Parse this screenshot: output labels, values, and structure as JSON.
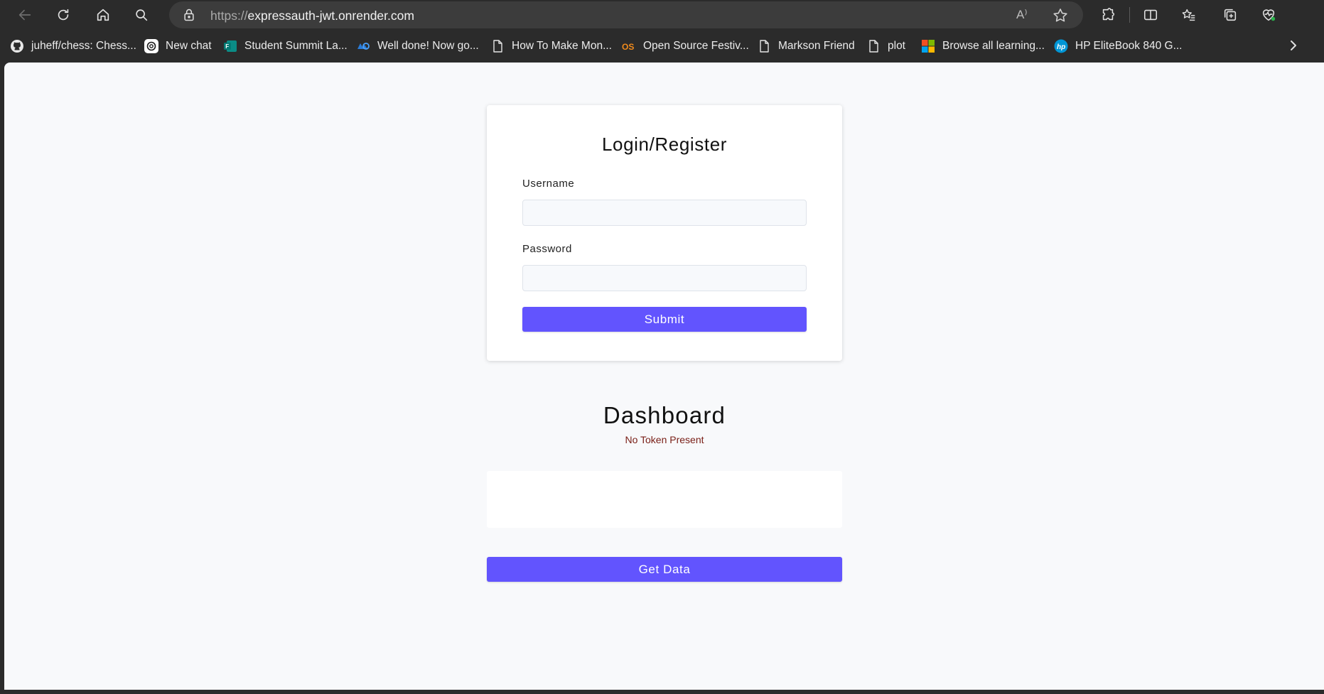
{
  "browser": {
    "url_protocol": "https://",
    "url_host": "expressauth-jwt.onrender.com",
    "read_aloud_label": "A⁾"
  },
  "bookmarks": [
    {
      "label": "juheff/chess: Chess...",
      "icon": "github-icon"
    },
    {
      "label": "New chat",
      "icon": "chatgpt-icon"
    },
    {
      "label": "Student Summit La...",
      "icon": "forms-icon"
    },
    {
      "label": "Well done! Now go...",
      "icon": "quiz-icon"
    },
    {
      "label": "How To Make Mon...",
      "icon": "page-icon"
    },
    {
      "label": "Open Source Festiv...",
      "icon": "osf-icon"
    },
    {
      "label": "Markson Friend",
      "icon": "page-icon"
    },
    {
      "label": "plot",
      "icon": "page-icon"
    },
    {
      "label": "Browse all learning...",
      "icon": "microsoft-icon"
    },
    {
      "label": "HP EliteBook 840 G...",
      "icon": "hp-icon"
    }
  ],
  "login": {
    "title": "Login/Register",
    "username_label": "Username",
    "username_value": "",
    "password_label": "Password",
    "password_value": "",
    "submit_label": "Submit"
  },
  "dashboard": {
    "title": "Dashboard",
    "status": "No Token Present",
    "get_data_label": "Get Data"
  },
  "colors": {
    "accent": "#6254fe",
    "status_text": "#7a2018",
    "page_background": "#f8f9fb",
    "browser_chrome": "#2b2b2b"
  }
}
